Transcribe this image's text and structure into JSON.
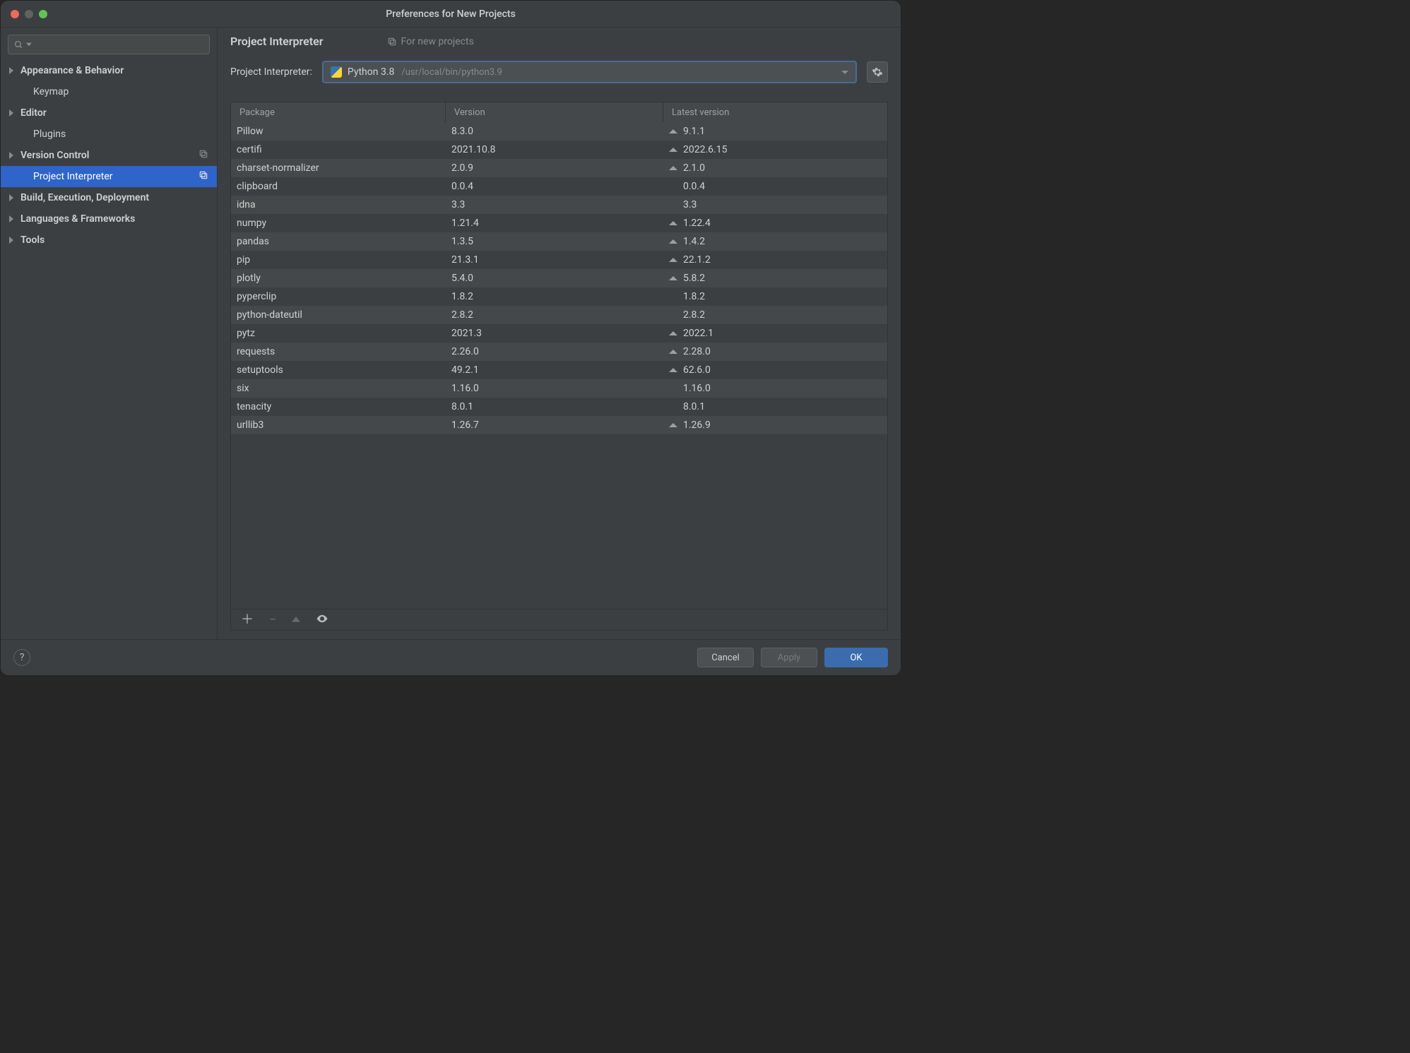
{
  "window_title": "Preferences for New Projects",
  "sidebar": {
    "search_placeholder": "",
    "items": [
      {
        "label": "Appearance & Behavior",
        "expandable": true,
        "level": 0
      },
      {
        "label": "Keymap",
        "expandable": false,
        "level": 1
      },
      {
        "label": "Editor",
        "expandable": true,
        "level": 0
      },
      {
        "label": "Plugins",
        "expandable": false,
        "level": 1
      },
      {
        "label": "Version Control",
        "expandable": true,
        "level": 0,
        "trail_icon": "copy-icon"
      },
      {
        "label": "Project Interpreter",
        "expandable": false,
        "level": 1,
        "selected": true,
        "trail_icon": "copy-icon"
      },
      {
        "label": "Build, Execution, Deployment",
        "expandable": true,
        "level": 0
      },
      {
        "label": "Languages & Frameworks",
        "expandable": true,
        "level": 0
      },
      {
        "label": "Tools",
        "expandable": true,
        "level": 0
      }
    ]
  },
  "main": {
    "heading": "Project Interpreter",
    "for_new_projects_label": "For new projects",
    "interpreter_label": "Project Interpreter:",
    "interpreter_name": "Python 3.8",
    "interpreter_path": "/usr/local/bin/python3.9"
  },
  "table": {
    "columns": {
      "package": "Package",
      "version": "Version",
      "latest": "Latest version"
    },
    "rows": [
      {
        "package": "Pillow",
        "version": "8.3.0",
        "latest": "9.1.1",
        "upgrade": true
      },
      {
        "package": "certifi",
        "version": "2021.10.8",
        "latest": "2022.6.15",
        "upgrade": true
      },
      {
        "package": "charset-normalizer",
        "version": "2.0.9",
        "latest": "2.1.0",
        "upgrade": true
      },
      {
        "package": "clipboard",
        "version": "0.0.4",
        "latest": "0.0.4",
        "upgrade": false
      },
      {
        "package": "idna",
        "version": "3.3",
        "latest": "3.3",
        "upgrade": false
      },
      {
        "package": "numpy",
        "version": "1.21.4",
        "latest": "1.22.4",
        "upgrade": true
      },
      {
        "package": "pandas",
        "version": "1.3.5",
        "latest": "1.4.2",
        "upgrade": true
      },
      {
        "package": "pip",
        "version": "21.3.1",
        "latest": "22.1.2",
        "upgrade": true
      },
      {
        "package": "plotly",
        "version": "5.4.0",
        "latest": "5.8.2",
        "upgrade": true
      },
      {
        "package": "pyperclip",
        "version": "1.8.2",
        "latest": "1.8.2",
        "upgrade": false
      },
      {
        "package": "python-dateutil",
        "version": "2.8.2",
        "latest": "2.8.2",
        "upgrade": false
      },
      {
        "package": "pytz",
        "version": "2021.3",
        "latest": "2022.1",
        "upgrade": true
      },
      {
        "package": "requests",
        "version": "2.26.0",
        "latest": "2.28.0",
        "upgrade": true
      },
      {
        "package": "setuptools",
        "version": "49.2.1",
        "latest": "62.6.0",
        "upgrade": true
      },
      {
        "package": "six",
        "version": "1.16.0",
        "latest": "1.16.0",
        "upgrade": false
      },
      {
        "package": "tenacity",
        "version": "8.0.1",
        "latest": "8.0.1",
        "upgrade": false
      },
      {
        "package": "urllib3",
        "version": "1.26.7",
        "latest": "1.26.9",
        "upgrade": true
      }
    ]
  },
  "footer": {
    "cancel": "Cancel",
    "apply": "Apply",
    "ok": "OK"
  }
}
